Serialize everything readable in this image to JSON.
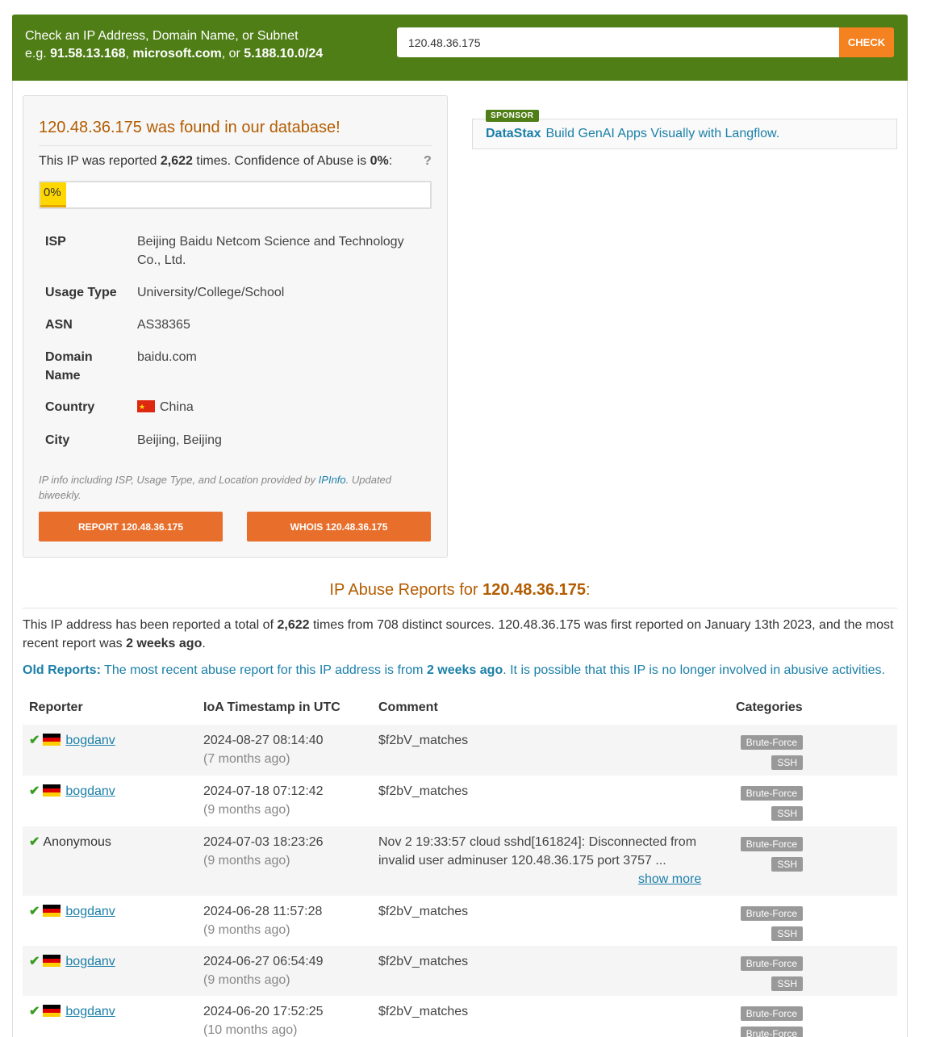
{
  "search": {
    "lead_line1": "Check an IP Address, Domain Name, or Subnet",
    "lead_eg": "e.g.",
    "example1": "91.58.13.168",
    "example2": "microsoft.com",
    "sep1": ",",
    "sep2": ", or",
    "example3": "5.188.10.0/24",
    "value": "120.48.36.175",
    "check_label": "CHECK"
  },
  "panel": {
    "found_ip": "120.48.36.175",
    "found_text": "was found in our database!",
    "reported_prefix": "This IP was reported",
    "reported_count": "2,622",
    "reported_mid": "times. Confidence of Abuse is",
    "confidence": "0%",
    "confidence_value": 0,
    "help": "?",
    "confidence_bar_label": "0%",
    "info": [
      {
        "label": "ISP",
        "value": "Beijing Baidu Netcom Science and Technology Co., Ltd."
      },
      {
        "label": "Usage Type",
        "value": "University/College/School"
      },
      {
        "label": "ASN",
        "value": "AS38365"
      },
      {
        "label": "Domain Name",
        "value": "baidu.com"
      },
      {
        "label": "Country",
        "value": "China"
      },
      {
        "label": "City",
        "value": "Beijing, Beijing"
      }
    ],
    "note_prefix": "IP info including ISP, Usage Type, and Location provided by",
    "note_link": "IPInfo",
    "note_suffix": ". Updated biweekly.",
    "report_button": "REPORT 120.48.36.175",
    "whois_button": "WHOIS 120.48.36.175"
  },
  "sponsor": {
    "tag": "SPONSOR",
    "brand": "DataStax",
    "text": "Build GenAI Apps Visually with Langflow."
  },
  "reports": {
    "title_prefix": "IP Abuse Reports for",
    "title_ip": "120.48.36.175",
    "title_suffix": ":",
    "summary_1": "This IP address has been reported a total of",
    "summary_count": "2,622",
    "summary_2": "times from 708 distinct sources. 120.48.36.175 was first reported on January 13th 2023, and the most recent report was",
    "summary_recent": "2 weeks ago",
    "summary_end": ".",
    "old_label": "Old Reports:",
    "old_text_1": "The most recent abuse report for this IP address is from",
    "old_recent": "2 weeks ago",
    "old_text_2": ". It is possible that this IP is no longer involved in abusive activities.",
    "columns": {
      "reporter": "Reporter",
      "timestamp": "IoA Timestamp in UTC",
      "comment": "Comment",
      "categories": "Categories"
    },
    "rows": [
      {
        "reporter": "bogdanv",
        "ts": "2024-08-27 08:14:40",
        "ago": "(7 months ago)",
        "comment": "$f2bV_matches",
        "cat1": "Brute-Force",
        "cat2": "SSH"
      },
      {
        "reporter": "bogdanv",
        "ts": "2024-07-18 07:12:42",
        "ago": "(9 months ago)",
        "comment": "$f2bV_matches",
        "cat1": "Brute-Force",
        "cat2": "SSH"
      },
      {
        "reporter": "Anonymous",
        "ts": "2024-07-03 18:23:26",
        "ago": "(9 months ago)",
        "comment": "Nov 2 19:33:57 cloud sshd[161824]: Disconnected from invalid user adminuser 120.48.36.175 port 3757 ...",
        "show_more": "show more",
        "cat1": "Brute-Force",
        "cat2": "SSH"
      },
      {
        "reporter": "bogdanv",
        "ts": "2024-06-28 11:57:28",
        "ago": "(9 months ago)",
        "comment": "$f2bV_matches",
        "cat1": "Brute-Force",
        "cat2": "SSH"
      },
      {
        "reporter": "bogdanv",
        "ts": "2024-06-27 06:54:49",
        "ago": "(9 months ago)",
        "comment": "$f2bV_matches",
        "cat1": "Brute-Force",
        "cat2": "SSH"
      },
      {
        "reporter": "bogdanv",
        "ts": "2024-06-20 17:52:25",
        "ago": "(10 months ago)",
        "comment": "$f2bV_matches",
        "cat1": "Brute-Force",
        "cat2": "Brute-Force"
      }
    ]
  },
  "colors": {
    "brand_green": "#4f7d16",
    "accent_orange": "#f58220",
    "heading_brown": "#b35c00",
    "link_blue": "#1a7fa8",
    "confidence_yellow": "#ffd700"
  }
}
